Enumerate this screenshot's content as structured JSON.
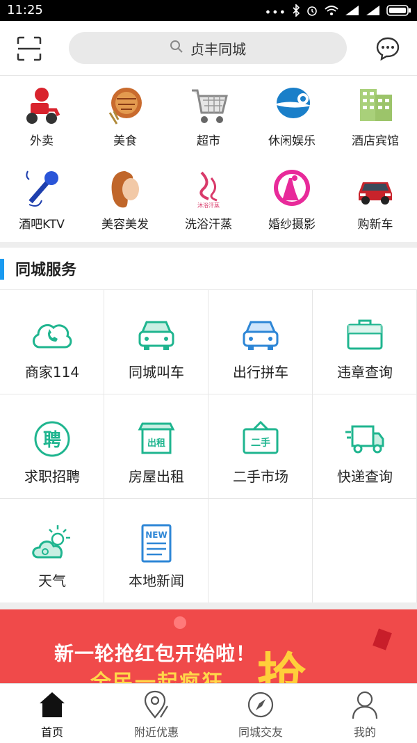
{
  "status": {
    "time": "11:25"
  },
  "header": {
    "search_text": "贞丰同城"
  },
  "categories": [
    {
      "label": "外卖",
      "icon": "delivery-icon"
    },
    {
      "label": "美食",
      "icon": "food-icon"
    },
    {
      "label": "超市",
      "icon": "shopping-cart-icon"
    },
    {
      "label": "休闲娱乐",
      "icon": "leisure-icon"
    },
    {
      "label": "酒店宾馆",
      "icon": "hotel-icon"
    },
    {
      "label": "酒吧KTV",
      "icon": "microphone-icon"
    },
    {
      "label": "美容美发",
      "icon": "beauty-icon"
    },
    {
      "label": "洗浴汗蒸",
      "icon": "bath-icon"
    },
    {
      "label": "婚纱摄影",
      "icon": "wedding-icon"
    },
    {
      "label": "购新车",
      "icon": "car-icon"
    }
  ],
  "section": {
    "title": "同城服务"
  },
  "services": [
    {
      "label": "商家114",
      "icon": "phone-cloud-icon"
    },
    {
      "label": "同城叫车",
      "icon": "taxi-icon"
    },
    {
      "label": "出行拼车",
      "icon": "carpool-icon"
    },
    {
      "label": "违章查询",
      "icon": "briefcase-icon"
    },
    {
      "label": "求职招聘",
      "icon": "hire-icon",
      "glyph": "聘"
    },
    {
      "label": "房屋出租",
      "icon": "house-rent-icon",
      "glyph": "出租"
    },
    {
      "label": "二手市场",
      "icon": "second-hand-icon",
      "glyph": "二手"
    },
    {
      "label": "快递查询",
      "icon": "delivery-truck-icon"
    },
    {
      "label": "天气",
      "icon": "weather-icon"
    },
    {
      "label": "本地新闻",
      "icon": "news-icon",
      "glyph": "NEW"
    }
  ],
  "banner": {
    "line1": "新一轮抢红包开始啦！",
    "line2": "全民一起疯狂",
    "big": "抢"
  },
  "tabs": [
    {
      "label": "首页",
      "icon": "home-icon"
    },
    {
      "label": "附近优惠",
      "icon": "location-icon"
    },
    {
      "label": "同城交友",
      "icon": "compass-icon"
    },
    {
      "label": "我的",
      "icon": "user-icon"
    }
  ],
  "colors": {
    "accent": "#1a9af0",
    "service_green": "#1fb58f",
    "banner_red": "#f04a4a"
  }
}
